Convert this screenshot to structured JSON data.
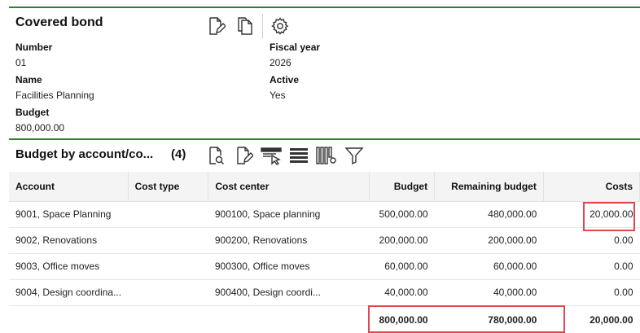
{
  "record": {
    "title": "Covered bond",
    "fields": {
      "number_label": "Number",
      "number_value": "01",
      "name_label": "Name",
      "name_value": "Facilities Planning",
      "budget_label": "Budget",
      "budget_value": "800,000.00",
      "fiscal_year_label": "Fiscal year",
      "fiscal_year_value": "2026",
      "active_label": "Active",
      "active_value": "Yes"
    },
    "toolbar_icons": [
      "edit-document-icon",
      "copy-document-icon",
      "settings-gear-icon"
    ]
  },
  "grid": {
    "title": "Budget by account/co...",
    "count": "(4)",
    "toolbar_icons": [
      "search-document-icon",
      "edit-document-icon",
      "filter-selection-icon",
      "rows-list-icon",
      "column-settings-icon",
      "funnel-filter-icon"
    ],
    "columns": {
      "account": "Account",
      "cost_type": "Cost type",
      "cost_center": "Cost center",
      "budget": "Budget",
      "remaining": "Remaining budget",
      "costs": "Costs"
    },
    "rows": [
      {
        "account": "9001, Space Planning",
        "cost_type": "",
        "cost_center": "900100, Space planning",
        "budget": "500,000.00",
        "remaining": "480,000.00",
        "costs": "20,000.00"
      },
      {
        "account": "9002, Renovations",
        "cost_type": "",
        "cost_center": "900200, Renovations",
        "budget": "200,000.00",
        "remaining": "200,000.00",
        "costs": "0.00"
      },
      {
        "account": "9003, Office moves",
        "cost_type": "",
        "cost_center": "900300, Office moves",
        "budget": "60,000.00",
        "remaining": "60,000.00",
        "costs": "0.00"
      },
      {
        "account": "9004, Design coordina...",
        "cost_type": "",
        "cost_center": "900400, Design coordi...",
        "budget": "40,000.00",
        "remaining": "40,000.00",
        "costs": "0.00"
      }
    ],
    "totals": {
      "budget": "800,000.00",
      "remaining": "780,000.00",
      "costs": "20,000.00"
    }
  },
  "colors": {
    "accent_rule": "#2e7d32",
    "highlight": "#e0474c"
  }
}
